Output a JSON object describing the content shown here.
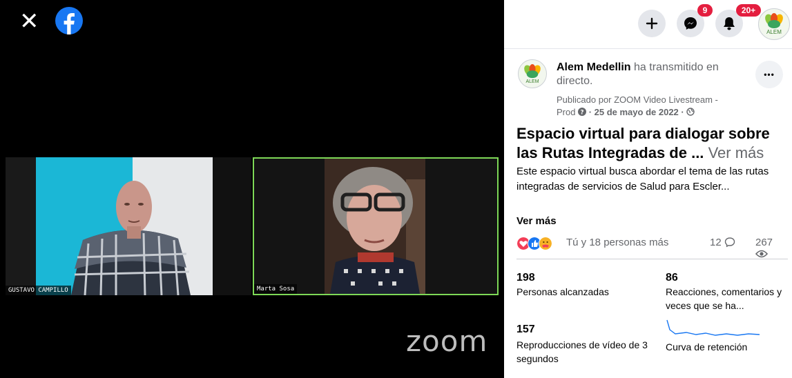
{
  "video": {
    "participants": [
      "GUSTAVO CAMPILLO",
      "Marta Sosa"
    ],
    "watermark": "zoom"
  },
  "topbar": {
    "messenger_badge": "9",
    "notifications_badge": "20+",
    "profile_label": "ALEM"
  },
  "post": {
    "page_name": "Alem Medellin",
    "action_text": " ha transmitido en directo.",
    "meta_line1": "Publicado por ZOOM Video Livestream -",
    "meta_prod": "Prod ",
    "meta_date": " · 25 de mayo de 2022 ·",
    "avatar_label": "ALEM",
    "more_label": "•••",
    "title": "Espacio virtual para dialogar sobre las Rutas Integradas de ...",
    "title_more": "Ver más",
    "description": "Este espacio virtual busca abordar el tema de las rutas integradas de servicios de Salud para Escler...",
    "description_more": "Ver más",
    "reactions_text": "Tú y 18 personas más",
    "comments_count": "12",
    "views_count": "267"
  },
  "stats": [
    {
      "number": "198",
      "label": "Personas alcanzadas"
    },
    {
      "number": "86",
      "label": "Reacciones, comentarios y veces que se ha..."
    },
    {
      "number": "157",
      "label": "Reproducciones de vídeo de 3 segundos"
    },
    {
      "number": "",
      "label": "Curva de retención"
    }
  ],
  "colors": {
    "facebook_blue": "#1877f2",
    "badge_red": "#e41e3f",
    "zoom_active_border": "#7ed957"
  }
}
